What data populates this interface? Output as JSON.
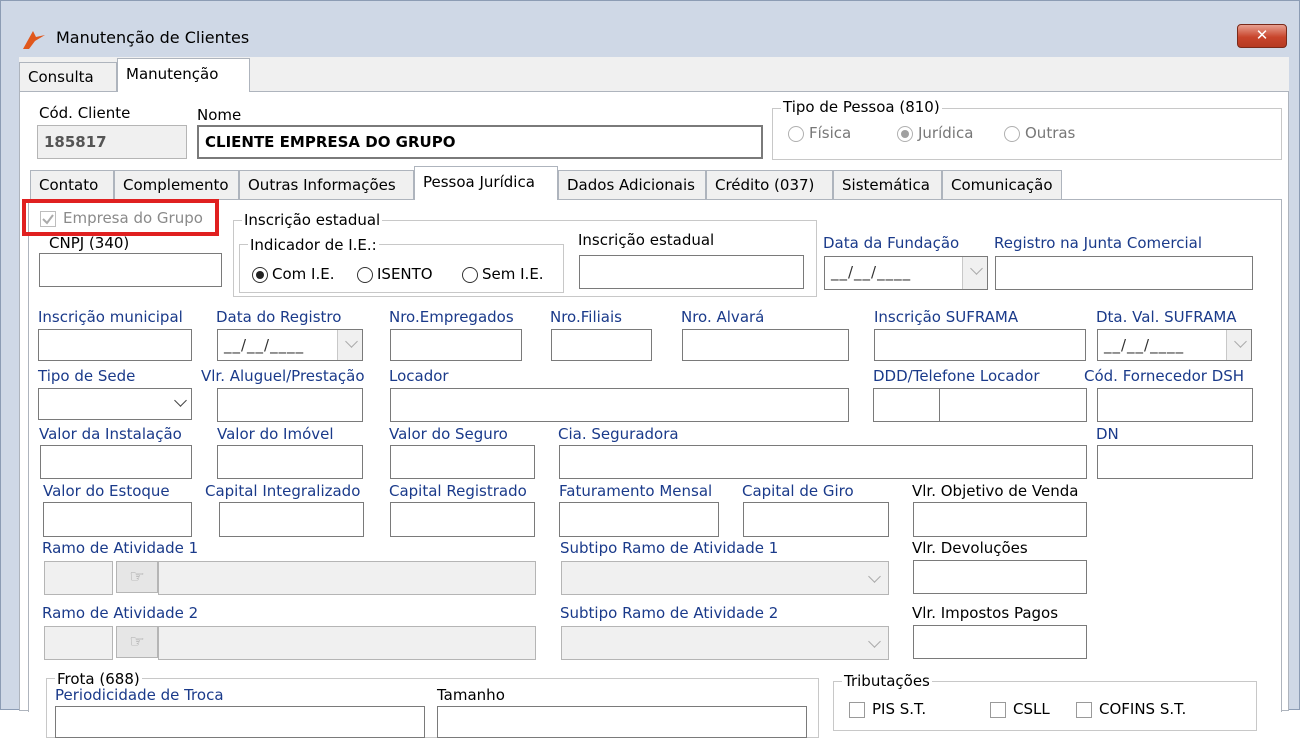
{
  "window": {
    "title": "Manutenção de Clientes",
    "close_label": "✕"
  },
  "main_tabs": [
    "Consulta",
    "Manutenção"
  ],
  "header": {
    "cod_cliente_label": "Cód. Cliente",
    "cod_cliente_value": "185817",
    "nome_label": "Nome",
    "nome_value": "CLIENTE EMPRESA DO GRUPO",
    "tipo_pessoa_label": "Tipo de Pessoa (810)",
    "tipo_pessoa_options": [
      "Física",
      "Jurídica",
      "Outras"
    ],
    "tipo_pessoa_selected": "Jurídica"
  },
  "sub_tabs": [
    "Contato",
    "Complemento",
    "Outras Informações",
    "Pessoa Jurídica",
    "Dados Adicionais",
    "Crédito (037)",
    "Sistemática",
    "Comunicação"
  ],
  "pj": {
    "empresa_grupo_label": "Empresa do Grupo",
    "cnpj_label": "CNPJ (340)",
    "ie_group_label": "Inscrição estadual",
    "indicador_label": "Indicador de I.E.:",
    "indicador_options": [
      "Com I.E.",
      "ISENTO",
      "Sem I.E."
    ],
    "indicador_selected": "Com I.E.",
    "ie_label": "Inscrição estadual",
    "data_fundacao_label": "Data da Fundação",
    "registro_junta_label": "Registro na Junta Comercial",
    "date_mask": "__/__/____",
    "inscricao_municipal_label": "Inscrição municipal",
    "data_registro_label": "Data do Registro",
    "nro_empregados_label": "Nro.Empregados",
    "nro_filiais_label": "Nro.Filiais",
    "nro_alvara_label": "Nro. Alvará",
    "inscricao_suframa_label": "Inscrição SUFRAMA",
    "dta_val_suframa_label": "Dta. Val. SUFRAMA",
    "tipo_sede_label": "Tipo de Sede",
    "vlr_aluguel_label": "Vlr. Aluguel/Prestação",
    "locador_label": "Locador",
    "ddd_tel_locador_label": "DDD/Telefone Locador",
    "cod_fornecedor_label": "Cód. Fornecedor DSH",
    "valor_instalacao_label": "Valor da Instalação",
    "valor_imovel_label": "Valor do Imóvel",
    "valor_seguro_label": "Valor do Seguro",
    "cia_seguradora_label": "Cia. Seguradora",
    "dn_label": "DN",
    "valor_estoque_label": "Valor do Estoque",
    "capital_integralizado_label": "Capital Integralizado",
    "capital_registrado_label": "Capital Registrado",
    "faturamento_mensal_label": "Faturamento Mensal",
    "capital_giro_label": "Capital de Giro",
    "vlr_objetivo_venda_label": "Vlr. Objetivo de Venda",
    "ramo_atividade1_label": "Ramo de Atividade 1",
    "subtipo_ramo1_label": "Subtipo Ramo de Atividade 1",
    "vlr_devolucoes_label": "Vlr. Devoluções",
    "ramo_atividade2_label": "Ramo de Atividade 2",
    "subtipo_ramo2_label": "Subtipo Ramo de Atividade 2",
    "vlr_impostos_label": "Vlr. Impostos Pagos",
    "frota_label": "Frota (688)",
    "periodicidade_label": "Periodicidade de Troca",
    "tamanho_label": "Tamanho",
    "tributacoes_label": "Tributações",
    "trib_options": [
      "PIS S.T.",
      "CSLL",
      "COFINS S.T."
    ]
  },
  "colors": {
    "highlight": "#e02020",
    "window_bg": "#cfd8e6"
  }
}
